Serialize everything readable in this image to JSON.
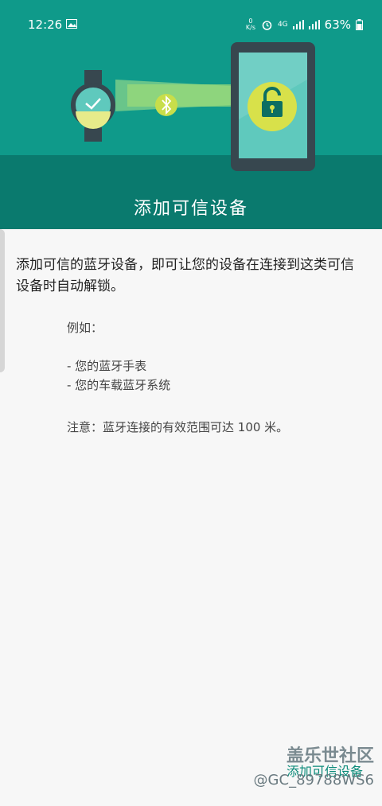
{
  "status_bar": {
    "time": "12:26",
    "kb_label": "0 K/s",
    "network_label": "4G",
    "battery": "63%"
  },
  "header": {
    "title": "添加可信设备",
    "illustration_icons": [
      "watch-icon",
      "bluetooth-icon",
      "phone-icon",
      "unlock-icon"
    ],
    "colors": {
      "primary": "#0f9a8a",
      "band": "#0a7a6e",
      "accent": "#d8e14a"
    }
  },
  "main": {
    "intro": "添加可信的蓝牙设备，即可让您的设备在连接到这类可信设备时自动解锁。",
    "examples_label": "例如：",
    "examples": [
      "- 您的蓝牙手表",
      "- 您的车载蓝牙系统"
    ],
    "note": "注意：蓝牙连接的有效范围可达 100 米。"
  },
  "footer": {
    "add_button_label": "添加可信设备",
    "watermark_brand": "盖乐世社区",
    "watermark_user": "@GC_89788WS6"
  }
}
